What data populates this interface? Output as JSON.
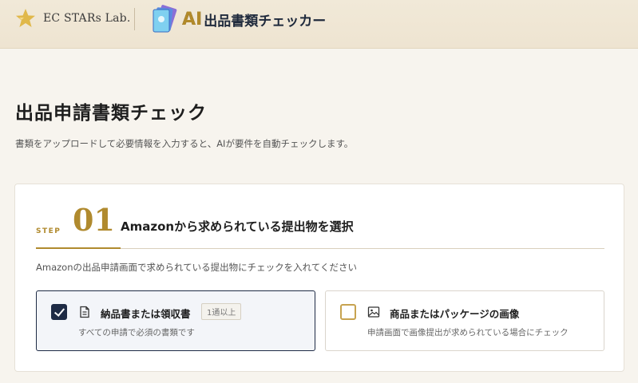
{
  "header": {
    "brand_name": "EC STARs Lab.",
    "app_ai": "AI",
    "app_name": "出品書類チェッカー",
    "icons": {
      "brand": "star-icon",
      "app": "cards-icon"
    }
  },
  "page": {
    "title": "出品申請書類チェック",
    "subtitle": "書類をアップロードして必要情報を入力すると、AIが要件を自動チェックします。"
  },
  "step": {
    "label": "STEP",
    "number": "01",
    "title": "Amazonから求められている提出物を選択",
    "instruction": "Amazonの出品申請画面で求められている提出物にチェックを入れてください"
  },
  "options": [
    {
      "title": "納品書または領収書",
      "badge": "1通以上",
      "description": "すべての申請で必須の書類です",
      "checked": true,
      "icon": "document-icon"
    },
    {
      "title": "商品またはパッケージの画像",
      "description": "申請画面で画像提出が求められている場合にチェック",
      "checked": false,
      "icon": "image-icon"
    }
  ],
  "colors": {
    "gold": "#b08a2e",
    "navy": "#1e2b45",
    "background": "#f7f4ee"
  }
}
